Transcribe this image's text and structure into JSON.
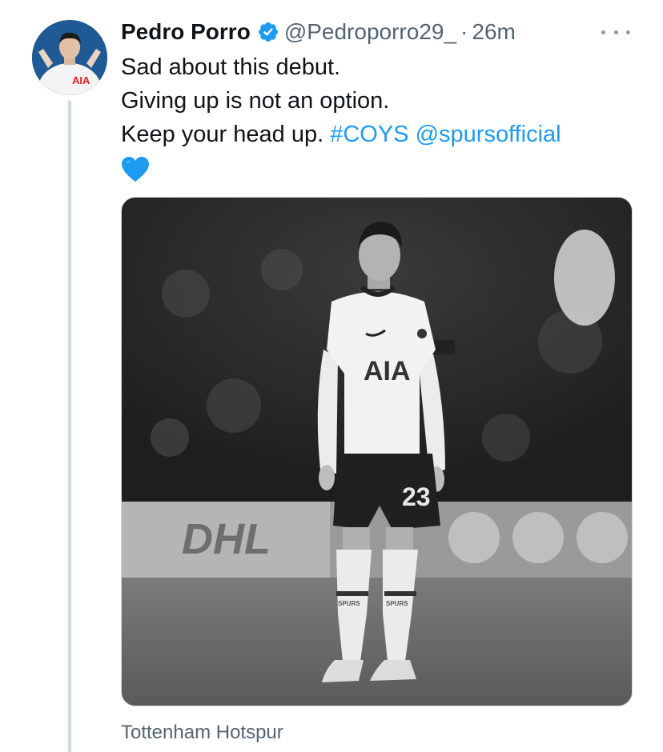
{
  "tweet": {
    "author": {
      "display_name": "Pedro Porro",
      "handle": "@Pedroporro29_",
      "verified": true,
      "avatar_icon": "avatar"
    },
    "separator": "·",
    "timestamp": "26m",
    "more_icon": "more-icon",
    "text": {
      "line1": "Sad about this debut.",
      "line2": "Giving up is not an option.",
      "line3_prefix": "Keep your head up. ",
      "hashtag": "#COYS",
      "mention": "@spursofficial",
      "emoji_icon": "blue-heart-icon"
    },
    "media": {
      "image_icon": "player-photo",
      "jersey_sponsor": "AIA",
      "jersey_number": "23",
      "sock_text": "SPURS",
      "board_text": "DHL"
    },
    "caption": "Tottenham Hotspur"
  },
  "colors": {
    "link": "#1d9bf0",
    "secondary_text": "#536471",
    "verified": "#1d9bf0",
    "heart": "#1d9bf0"
  }
}
